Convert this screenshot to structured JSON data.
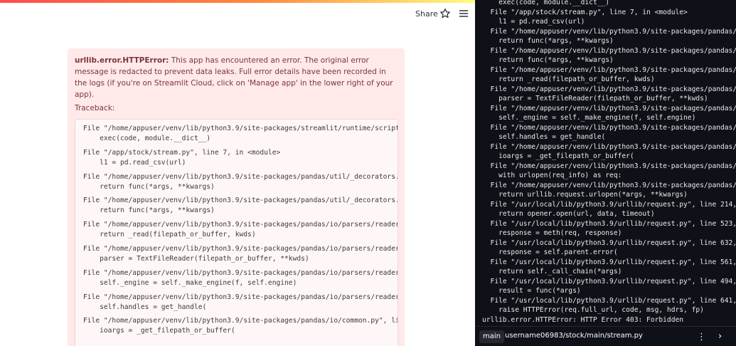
{
  "header": {
    "share_label": "Share"
  },
  "error": {
    "type": "urllib.error.HTTPError:",
    "message": "This app has encountered an error. The original error message is redacted to prevent data leaks. Full error details have been recorded in the logs (if you're on Streamlit Cloud, click on 'Manage app' in the lower right of your app).",
    "traceback_label": "Traceback:",
    "traceback": [
      {
        "file": "File \"/home/appuser/venv/lib/python3.9/site-packages/streamlit/runtime/scriptr",
        "code": "    exec(code, module.__dict__)"
      },
      {
        "file": "File \"/app/stock/stream.py\", line 7, in <module>",
        "code": "    l1 = pd.read_csv(url)"
      },
      {
        "file": "File \"/home/appuser/venv/lib/python3.9/site-packages/pandas/util/_decorators.p",
        "code": "    return func(*args, **kwargs)"
      },
      {
        "file": "File \"/home/appuser/venv/lib/python3.9/site-packages/pandas/util/_decorators.p",
        "code": "    return func(*args, **kwargs)"
      },
      {
        "file": "File \"/home/appuser/venv/lib/python3.9/site-packages/pandas/io/parsers/readers",
        "code": "    return _read(filepath_or_buffer, kwds)"
      },
      {
        "file": "File \"/home/appuser/venv/lib/python3.9/site-packages/pandas/io/parsers/readers",
        "code": "    parser = TextFileReader(filepath_or_buffer, **kwds)"
      },
      {
        "file": "File \"/home/appuser/venv/lib/python3.9/site-packages/pandas/io/parsers/readers",
        "code": "    self._engine = self._make_engine(f, self.engine)"
      },
      {
        "file": "File \"/home/appuser/venv/lib/python3.9/site-packages/pandas/io/parsers/readers",
        "code": "    self.handles = get_handle("
      },
      {
        "file": "File \"/home/appuser/venv/lib/python3.9/site-packages/pandas/io/common.py\", lin",
        "code": "    ioargs = _get_filepath_or_buffer("
      }
    ]
  },
  "terminal": {
    "lines": [
      "    exec(code, module.__dict__)",
      "  File \"/app/stock/stream.py\", line 7, in <module>",
      "    l1 = pd.read_csv(url)",
      "  File \"/home/appuser/venv/lib/python3.9/site-packages/pandas/",
      "    return func(*args, **kwargs)",
      "  File \"/home/appuser/venv/lib/python3.9/site-packages/pandas/",
      "    return func(*args, **kwargs)",
      "  File \"/home/appuser/venv/lib/python3.9/site-packages/pandas/",
      "    return _read(filepath_or_buffer, kwds)",
      "  File \"/home/appuser/venv/lib/python3.9/site-packages/pandas/",
      "    parser = TextFileReader(filepath_or_buffer, **kwds)",
      "  File \"/home/appuser/venv/lib/python3.9/site-packages/pandas/",
      "    self._engine = self._make_engine(f, self.engine)",
      "  File \"/home/appuser/venv/lib/python3.9/site-packages/pandas/",
      "    self.handles = get_handle(",
      "  File \"/home/appuser/venv/lib/python3.9/site-packages/pandas/",
      "    ioargs = _get_filepath_or_buffer(",
      "  File \"/home/appuser/venv/lib/python3.9/site-packages/pandas/",
      "    with urlopen(req_info) as req:",
      "  File \"/home/appuser/venv/lib/python3.9/site-packages/pandas/",
      "    return urllib.request.urlopen(*args, **kwargs)",
      "  File \"/usr/local/lib/python3.9/urllib/request.py\", line 214,",
      "    return opener.open(url, data, timeout)",
      "  File \"/usr/local/lib/python3.9/urllib/request.py\", line 523,",
      "    response = meth(req, response)",
      "  File \"/usr/local/lib/python3.9/urllib/request.py\", line 632,",
      "    response = self.parent.error(",
      "  File \"/usr/local/lib/python3.9/urllib/request.py\", line 561,",
      "    return self._call_chain(*args)",
      "  File \"/usr/local/lib/python3.9/urllib/request.py\", line 494,",
      "    result = func(*args)",
      "  File \"/usr/local/lib/python3.9/urllib/request.py\", line 641,",
      "    raise HTTPError(req.full_url, code, msg, hdrs, fp)",
      "urllib.error.HTTPError: HTTP Error 403: Forbidden"
    ],
    "branch": "main",
    "path": "username06983/stock/main/stream.py",
    "kebab_glyph": "⋮",
    "chevron_glyph": "›"
  },
  "colors": {
    "error_bg": "#ffe9e9",
    "error_text": "#7d353b",
    "terminal_bg": "#0e1117",
    "terminal_text": "#eaeaea"
  }
}
